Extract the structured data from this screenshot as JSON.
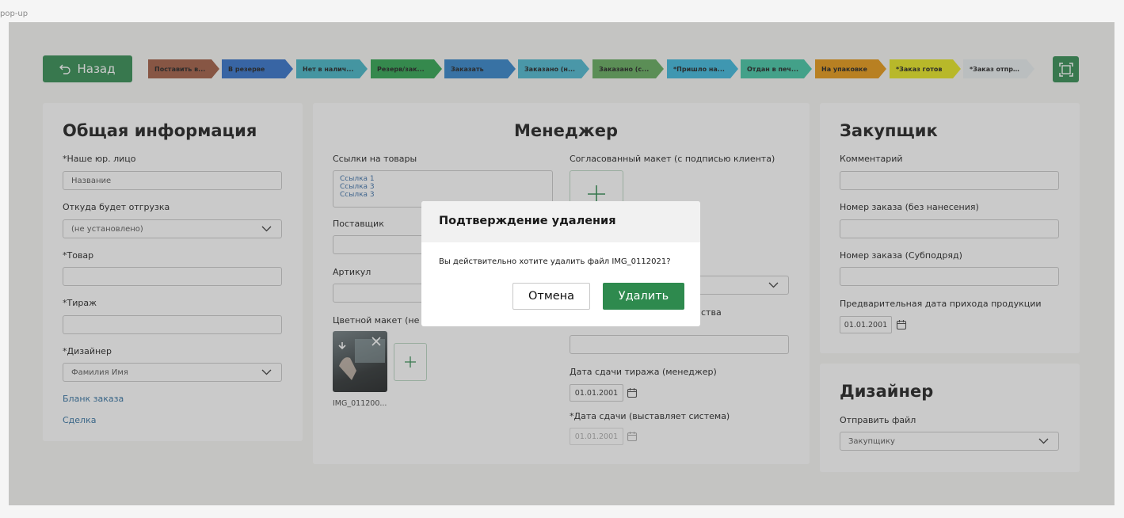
{
  "frame_label": "pop-up",
  "topbar": {
    "back_label": "Назад",
    "steps": [
      {
        "label": "Поставить в...",
        "color": "#a05a3f"
      },
      {
        "label": "В резерве",
        "color": "#2e6fc9"
      },
      {
        "label": "Нет в налич...",
        "color": "#3fb3c4"
      },
      {
        "label": "Резерв/зак...",
        "color": "#2aa24c"
      },
      {
        "label": "Заказать",
        "color": "#2f82c9"
      },
      {
        "label": "Заказано (н...",
        "color": "#48b6cf"
      },
      {
        "label": "Заказано (с...",
        "color": "#61a95a"
      },
      {
        "label": "*Пришло на...",
        "color": "#38b7dc"
      },
      {
        "label": "Отдан в печ...",
        "color": "#3ec5a3"
      },
      {
        "label": "На упаковке",
        "color": "#e6960f"
      },
      {
        "label": "*Заказ готов",
        "color": "#e6e51a"
      },
      {
        "label": "*Заказ отпра...",
        "color": "#e9eef0"
      }
    ]
  },
  "general": {
    "title": "Общая информация",
    "legal_label": "*Наше юр. лицо",
    "legal_placeholder": "Название",
    "ship_from_label": "Откуда будет отгрузка",
    "ship_from_value": "(не установлено)",
    "product_label": "*Товар",
    "run_label": "*Тираж",
    "designer_label": "*Дизайнер",
    "designer_value": "Фамилия Имя",
    "order_form_link": "Бланк заказа",
    "deal_link": "Сделка"
  },
  "manager": {
    "title": "Менеджер",
    "links_label": "Ссылки на товары",
    "links": [
      "Ссылка 1",
      "Ссылка 3",
      "Ссылка 3"
    ],
    "approved_label": "Согласованный макет (с подписью клиента)",
    "supplier_label": "Поставщик",
    "article_label": "Артикул",
    "color_layout_label": "Цветной макет (не",
    "quantity_fragment": "ства",
    "file_caption": "IMG_011200...",
    "run_date_label": "Дата сдачи тиража (менеджер)",
    "run_date_value": "01.01.2001",
    "system_date_label": "*Дата сдачи (выставляет система)",
    "system_date_value": "01.01.2001"
  },
  "buyer": {
    "title": "Закупщик",
    "comment_label": "Комментарий",
    "order_no_label": "Номер заказа (без нанесения)",
    "sub_order_label": "Номер заказа (Субподряд)",
    "arrival_label": "Предварительная дата прихода продукции",
    "arrival_value": "01.01.2001"
  },
  "designer": {
    "title": "Дизайнер",
    "send_label": "Отправить файл",
    "send_value": "Закупщику"
  },
  "modal": {
    "title": "Подтверждение удаления",
    "text": "Вы действительно хотите удалить файл IMG_0112021?",
    "cancel": "Отмена",
    "delete": "Удалить"
  },
  "colors": {
    "primary": "#2e8a4e",
    "link": "#2f6f9f"
  }
}
